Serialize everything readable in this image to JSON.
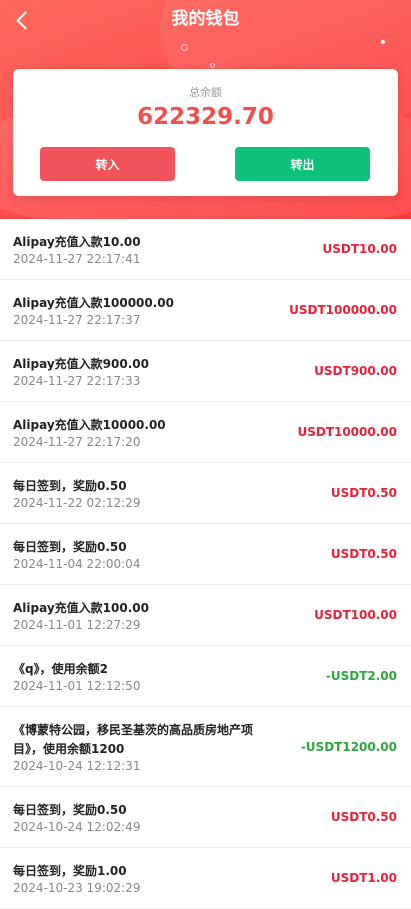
{
  "header": {
    "title": "我的钱包",
    "back_icon": "chevron-left-icon"
  },
  "wallet": {
    "balance_label": "总余额",
    "balance": "622329.70",
    "deposit_label": "转入",
    "withdraw_label": "转出"
  },
  "colors": {
    "brand": "#ff4c4c",
    "income": "#e5223a",
    "expense": "#2ea63c",
    "withdraw_button": "#0bc17b"
  },
  "transactions": [
    {
      "title": "Alipay充值入款10.00",
      "time": "2024-11-27 22:17:41",
      "amount": "USDT10.00",
      "type": "income"
    },
    {
      "title": "Alipay充值入款100000.00",
      "time": "2024-11-27 22:17:37",
      "amount": "USDT100000.00",
      "type": "income"
    },
    {
      "title": "Alipay充值入款900.00",
      "time": "2024-11-27 22:17:33",
      "amount": "USDT900.00",
      "type": "income"
    },
    {
      "title": "Alipay充值入款10000.00",
      "time": "2024-11-27 22:17:20",
      "amount": "USDT10000.00",
      "type": "income"
    },
    {
      "title": "每日签到，奖励0.50",
      "time": "2024-11-22 02:12:29",
      "amount": "USDT0.50",
      "type": "income"
    },
    {
      "title": "每日签到，奖励0.50",
      "time": "2024-11-04 22:00:04",
      "amount": "USDT0.50",
      "type": "income"
    },
    {
      "title": "Alipay充值入款100.00",
      "time": "2024-11-01 12:27:29",
      "amount": "USDT100.00",
      "type": "income"
    },
    {
      "title": "《q》，使用余额2",
      "time": "2024-11-01 12:12:50",
      "amount": "-USDT2.00",
      "type": "expense"
    },
    {
      "title": "《博蒙特公园，移民圣基茨的高品质房地产项目》，使用余额1200",
      "time": "2024-10-24 12:12:31",
      "amount": "-USDT1200.00",
      "type": "expense"
    },
    {
      "title": "每日签到，奖励0.50",
      "time": "2024-10-24 12:02:49",
      "amount": "USDT0.50",
      "type": "income"
    },
    {
      "title": "每日签到，奖励1.00",
      "time": "2024-10-23 19:02:29",
      "amount": "USDT1.00",
      "type": "income"
    }
  ]
}
